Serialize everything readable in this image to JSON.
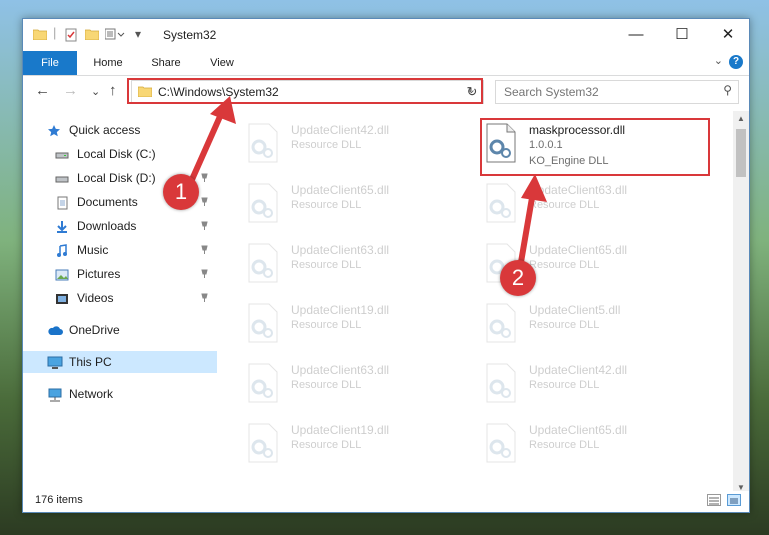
{
  "window": {
    "title": "System32",
    "minimize_glyph": "—",
    "maximize_glyph": "☐",
    "close_glyph": "✕"
  },
  "ribbon": {
    "tabs": [
      "File",
      "Home",
      "Share",
      "View"
    ],
    "help": "?",
    "collapse_glyph": "⌄"
  },
  "navigation": {
    "back_glyph": "←",
    "forward_glyph": "→",
    "recent_glyph": "⌄",
    "up_glyph": "↑",
    "address_path": "C:\\Windows\\System32",
    "address_dropdown_glyph": "⌄",
    "refresh_glyph": "↻",
    "search_placeholder": "Search System32",
    "search_glyph": "⚲"
  },
  "sidebar": {
    "items": [
      {
        "label": "Quick access",
        "icon": "star-icon",
        "pinned": false
      },
      {
        "label": "Local Disk (C:)",
        "icon": "drive-icon",
        "pinned": false
      },
      {
        "label": "Local Disk (D:)",
        "icon": "drive-icon",
        "pinned": true
      },
      {
        "label": "Documents",
        "icon": "documents-icon",
        "pinned": true
      },
      {
        "label": "Downloads",
        "icon": "downloads-icon",
        "pinned": true
      },
      {
        "label": "Music",
        "icon": "music-icon",
        "pinned": true
      },
      {
        "label": "Pictures",
        "icon": "pictures-icon",
        "pinned": true
      },
      {
        "label": "Videos",
        "icon": "videos-icon",
        "pinned": true
      },
      {
        "label": "OneDrive",
        "icon": "cloud-icon",
        "pinned": false
      },
      {
        "label": "This PC",
        "icon": "computer-icon",
        "pinned": false,
        "selected": true
      },
      {
        "label": "Network",
        "icon": "network-icon",
        "pinned": false
      }
    ],
    "pin_glyph": "📌"
  },
  "files": {
    "highlighted": {
      "name": "maskprocessor.dll",
      "version": "1.0.0.1",
      "description": "KO_Engine DLL"
    },
    "left_column": [
      {
        "name": "UpdateClient42.dll",
        "desc": "Resource DLL"
      },
      {
        "name": "UpdateClient65.dll",
        "desc": "Resource DLL"
      },
      {
        "name": "UpdateClient63.dll",
        "desc": "Resource DLL"
      },
      {
        "name": "UpdateClient19.dll",
        "desc": "Resource DLL"
      },
      {
        "name": "UpdateClient63.dll",
        "desc": "Resource DLL"
      },
      {
        "name": "UpdateClient19.dll",
        "desc": "Resource DLL"
      }
    ],
    "right_column": [
      {
        "name": "UpdateClient63.dll",
        "desc": "Resource DLL"
      },
      {
        "name": "UpdateClient65.dll",
        "desc": "Resource DLL"
      },
      {
        "name": "UpdateClient5.dll",
        "desc": "Resource DLL"
      },
      {
        "name": "UpdateClient42.dll",
        "desc": "Resource DLL"
      },
      {
        "name": "UpdateClient65.dll",
        "desc": "Resource DLL"
      }
    ]
  },
  "status": {
    "item_count": "176 items"
  },
  "annotations": {
    "step1": "1",
    "step2": "2",
    "color": "#d9383a"
  }
}
